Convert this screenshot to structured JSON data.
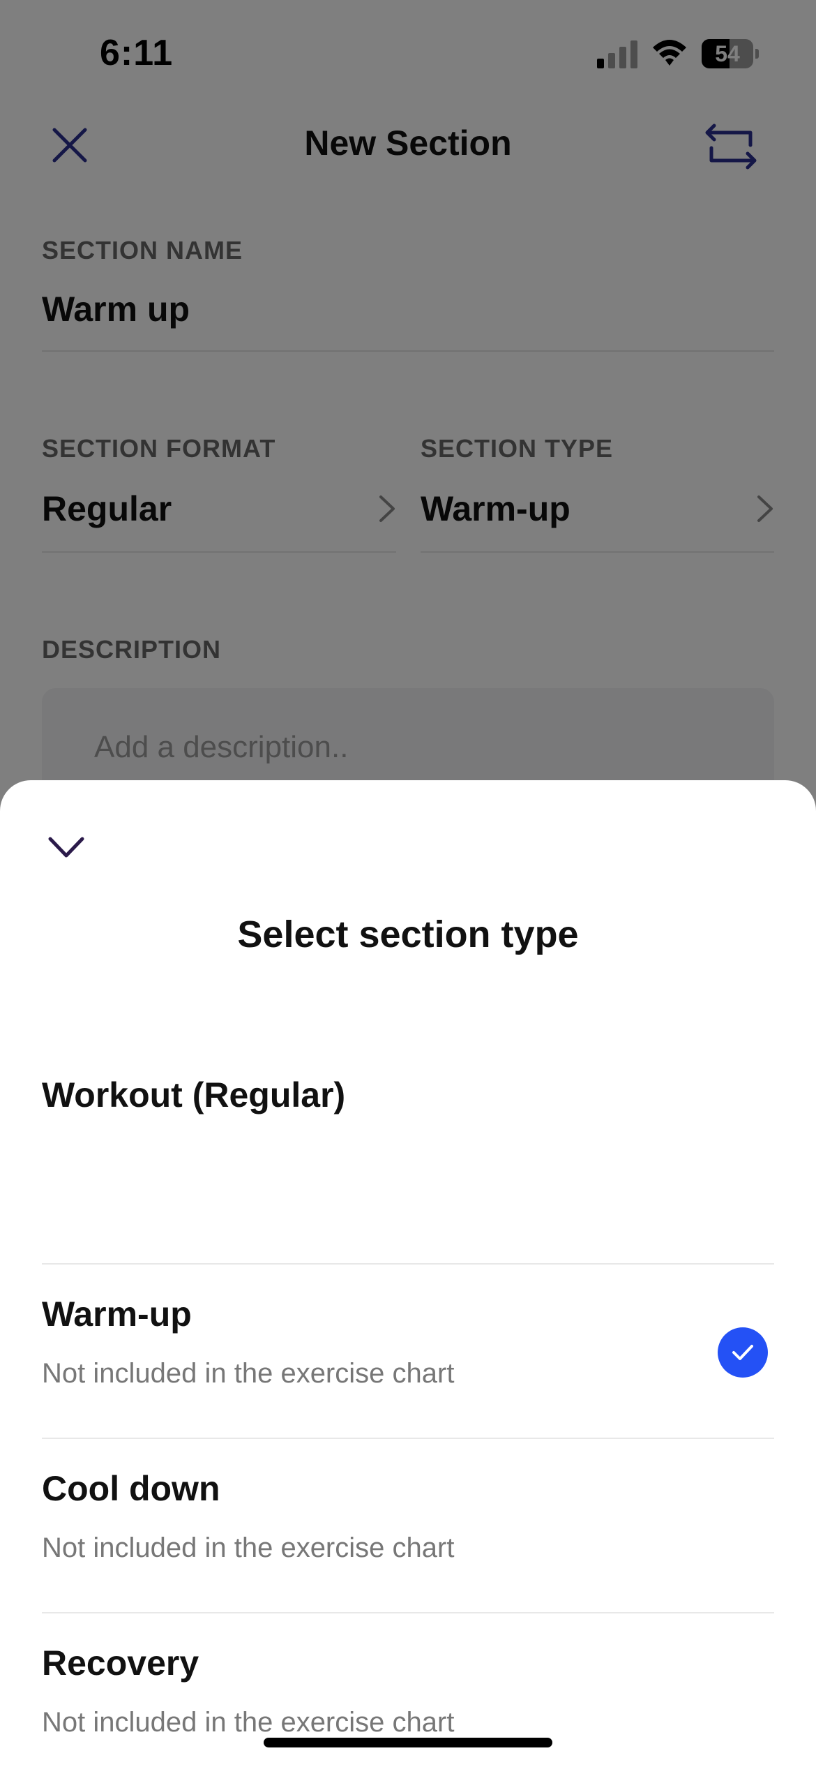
{
  "status_bar": {
    "time": "6:11",
    "battery_level": "54",
    "signal_bars_active": 1,
    "signal_bars_total": 4
  },
  "nav": {
    "title": "New Section",
    "close_icon": "close-icon",
    "swap_icon": "swap-arrows-icon"
  },
  "form": {
    "section_name": {
      "label": "SECTION NAME",
      "value": "Warm up"
    },
    "section_format": {
      "label": "SECTION FORMAT",
      "value": "Regular"
    },
    "section_type": {
      "label": "SECTION TYPE",
      "value": "Warm-up"
    },
    "description": {
      "label": "DESCRIPTION",
      "placeholder": "Add a description.."
    }
  },
  "sheet": {
    "title": "Select section type",
    "collapse_icon": "chevron-down-icon",
    "options": [
      {
        "title": "Workout (Regular)",
        "subtitle": "",
        "selected": false
      },
      {
        "title": "Warm-up",
        "subtitle": "Not included in the exercise chart",
        "selected": true
      },
      {
        "title": "Cool down",
        "subtitle": "Not included in the exercise chart",
        "selected": false
      },
      {
        "title": "Recovery",
        "subtitle": "Not included in the exercise chart",
        "selected": false
      }
    ]
  },
  "colors": {
    "accent": "#2451f5",
    "nav_icon": "#2a2f8f",
    "overlay": "rgba(0,0,0,0.5)"
  }
}
